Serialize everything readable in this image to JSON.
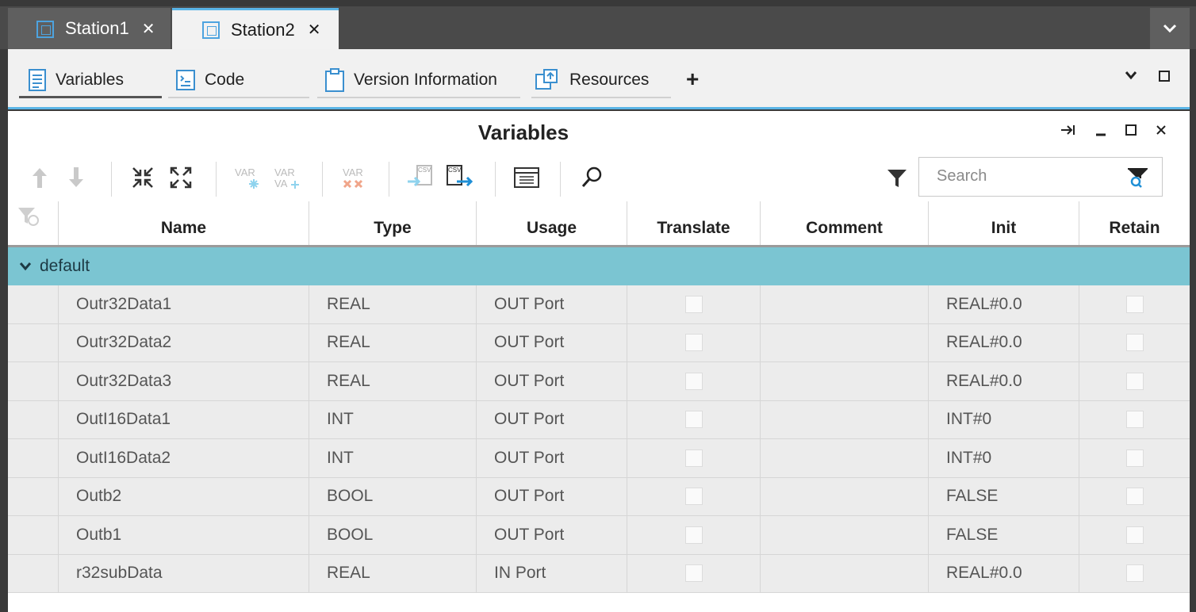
{
  "doc_tabs": [
    {
      "label": "Station1",
      "close": "✕",
      "active": false
    },
    {
      "label": "Station2",
      "close": "✕",
      "active": true
    }
  ],
  "sub_tabs": [
    {
      "label": "Variables",
      "icon": "list-document-icon",
      "active": true
    },
    {
      "label": "Code",
      "icon": "code-document-icon",
      "active": false
    },
    {
      "label": "Version Information",
      "icon": "clipboard-icon",
      "active": false
    },
    {
      "label": "Resources",
      "icon": "resources-icon",
      "active": false
    }
  ],
  "sub_tabs_add": "+",
  "panel": {
    "title": "Variables",
    "search_placeholder": "Search"
  },
  "toolbar": {
    "icons": [
      "move-up-icon",
      "move-down-icon",
      "collapse-all-icon",
      "expand-all-icon",
      "add-var-icon",
      "add-multi-var-icon",
      "delete-var-icon",
      "import-csv-icon",
      "export-csv-icon",
      "table-view-icon",
      "search-icon",
      "filter-icon"
    ]
  },
  "grid": {
    "columns": [
      "Name",
      "Type",
      "Usage",
      "Translate",
      "Comment",
      "Init",
      "Retain"
    ],
    "group": "default",
    "rows": [
      {
        "name": "Outr32Data1",
        "type": "REAL",
        "usage": "OUT Port",
        "translate": false,
        "comment": "",
        "init": "REAL#0.0",
        "retain": false
      },
      {
        "name": "Outr32Data2",
        "type": "REAL",
        "usage": "OUT Port",
        "translate": false,
        "comment": "",
        "init": "REAL#0.0",
        "retain": false
      },
      {
        "name": "Outr32Data3",
        "type": "REAL",
        "usage": "OUT Port",
        "translate": false,
        "comment": "",
        "init": "REAL#0.0",
        "retain": false
      },
      {
        "name": "OutI16Data1",
        "type": "INT",
        "usage": "OUT Port",
        "translate": false,
        "comment": "",
        "init": "INT#0",
        "retain": false
      },
      {
        "name": "OutI16Data2",
        "type": "INT",
        "usage": "OUT Port",
        "translate": false,
        "comment": "",
        "init": "INT#0",
        "retain": false
      },
      {
        "name": "Outb2",
        "type": "BOOL",
        "usage": "OUT Port",
        "translate": false,
        "comment": "",
        "init": "FALSE",
        "retain": false
      },
      {
        "name": "Outb1",
        "type": "BOOL",
        "usage": "OUT Port",
        "translate": false,
        "comment": "",
        "init": "FALSE",
        "retain": false
      },
      {
        "name": "r32subData",
        "type": "REAL",
        "usage": "IN Port",
        "translate": false,
        "comment": "",
        "init": "REAL#0.0",
        "retain": false
      }
    ]
  },
  "colors": {
    "accent": "#5ab4e6",
    "group_row": "#7bc5d2",
    "tab_bg_dark": "#4a4a4a"
  }
}
